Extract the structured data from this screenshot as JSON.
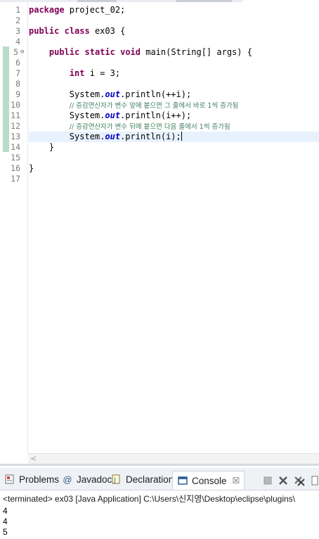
{
  "editor": {
    "line_numbers": [
      "1",
      "2",
      "3",
      "4",
      "5",
      "6",
      "7",
      "8",
      "9",
      "10",
      "11",
      "12",
      "13",
      "14",
      "15",
      "16",
      "17"
    ],
    "fold_marker_line": "5",
    "lines": {
      "l1": {
        "kw": "package",
        "rest": " project_02;"
      },
      "l3": {
        "kw1": "public",
        "kw2": "class",
        "rest": " ex03 {"
      },
      "l5": {
        "indent": "    ",
        "kw1": "public",
        "kw2": "static",
        "kw3": "void",
        "rest": " main(String[] args) {"
      },
      "l7": {
        "indent": "        ",
        "kw": "int",
        "rest": " i = 3;"
      },
      "l9": {
        "pre": "        System.",
        "field": "out",
        "post": ".println(++i);"
      },
      "l10": {
        "indent": "        ",
        "comment": "// 증감연산자가 변수 앞에 붙으면 그 줄에서 바로 1씩 증가됨"
      },
      "l11": {
        "pre": "        System.",
        "field": "out",
        "post": ".println(i++);"
      },
      "l12": {
        "indent": "        ",
        "comment": "// 증감연산자가 변수 뒤에 붙으면 다음 줄에서 1씩 증가됨"
      },
      "l13": {
        "pre": "        System.",
        "field": "out",
        "post": ".println(i);"
      },
      "l14": "    }",
      "l16": "}"
    },
    "scroll_left_glyph": "<"
  },
  "panel": {
    "tabs": [
      {
        "label": "Problems",
        "icon": "problems-icon"
      },
      {
        "label": "Javadoc",
        "icon": "javadoc-icon"
      },
      {
        "label": "Declaration",
        "icon": "declaration-icon"
      },
      {
        "label": "Console",
        "icon": "console-icon",
        "active": true
      }
    ],
    "close_glyph": "☒",
    "terminated_text": "<terminated> ex03 [Java Application] C:\\Users\\신지영\\Desktop\\eclipse\\plugins\\",
    "output": [
      "4",
      "4",
      "5"
    ]
  },
  "colors": {
    "keyword": "#7f0055",
    "field": "#0000c0",
    "comment": "#3f7f5f",
    "current_line": "#e8f2fe"
  }
}
